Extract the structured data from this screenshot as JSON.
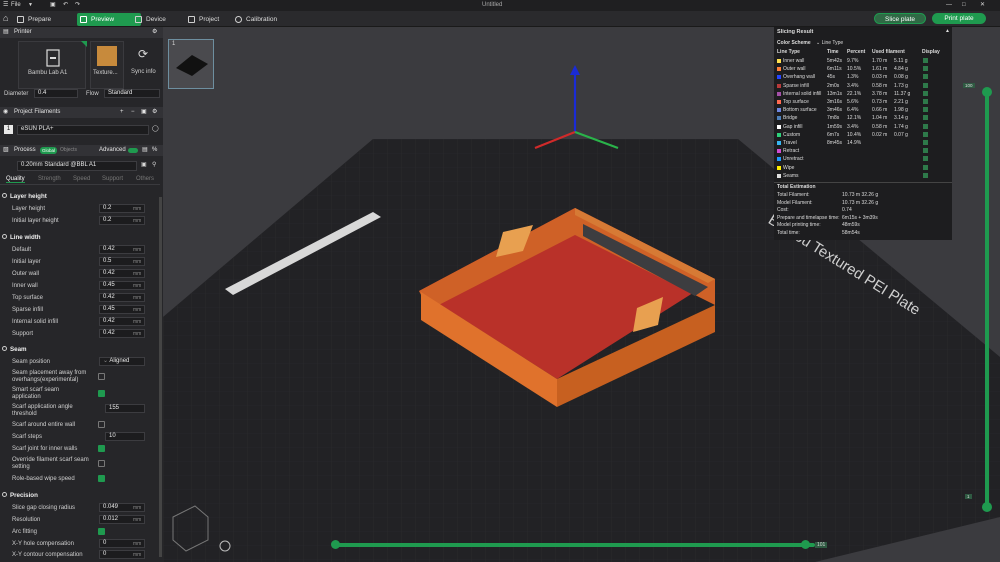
{
  "app": {
    "file_menu": "File",
    "document_title": "Untitled"
  },
  "tabs": [
    {
      "label": "Prepare"
    },
    {
      "label": "Preview"
    },
    {
      "label": "Device"
    },
    {
      "label": "Project"
    },
    {
      "label": "Calibration"
    }
  ],
  "actions": {
    "slice_plate": "Slice plate",
    "print_plate": "Print plate"
  },
  "printer": {
    "section_title": "Printer",
    "printer_name": "Bambu Lab A1",
    "plate_name": "Texture...",
    "sync_label": "Sync info",
    "diameter_label": "Diameter",
    "diameter_value": "0.4",
    "flow_label": "Flow",
    "flow_value": "Standard"
  },
  "filaments": {
    "section_title": "Project Filaments",
    "slot_number": "1",
    "filament_name": "eSUN PLA+"
  },
  "process": {
    "section_title": "Process",
    "toggle_global": "Global",
    "toggle_objects": "Objects",
    "advanced_label": "Advanced",
    "preset_name": "0.20mm Standard @BBL A1",
    "subtabs": [
      "Quality",
      "Strength",
      "Speed",
      "Support",
      "Others"
    ]
  },
  "layer_height": {
    "group_title": "Layer height",
    "rows": [
      {
        "label": "Layer height",
        "value": "0.2",
        "unit": "mm"
      },
      {
        "label": "Initial layer height",
        "value": "0.2",
        "unit": "mm"
      }
    ]
  },
  "line_width": {
    "group_title": "Line width",
    "rows": [
      {
        "label": "Default",
        "value": "0.42",
        "unit": "mm"
      },
      {
        "label": "Initial layer",
        "value": "0.5",
        "unit": "mm"
      },
      {
        "label": "Outer wall",
        "value": "0.42",
        "unit": "mm"
      },
      {
        "label": "Inner wall",
        "value": "0.45",
        "unit": "mm"
      },
      {
        "label": "Top surface",
        "value": "0.42",
        "unit": "mm"
      },
      {
        "label": "Sparse infill",
        "value": "0.45",
        "unit": "mm"
      },
      {
        "label": "Internal solid infill",
        "value": "0.42",
        "unit": "mm"
      },
      {
        "label": "Support",
        "value": "0.42",
        "unit": "mm"
      }
    ]
  },
  "seam": {
    "group_title": "Seam",
    "position_label": "Seam position",
    "position_value": "Aligned",
    "away_label_1": "Seam placement away from",
    "away_label_2": "overhangs(experimental)",
    "smart_label_1": "Smart scarf seam",
    "smart_label_2": "application",
    "angle_label_1": "Scarf application angle",
    "angle_label_2": "threshold",
    "angle_value": "155",
    "around_label": "Scarf around entire wall",
    "steps_label": "Scarf steps",
    "steps_value": "10",
    "inner_label": "Scarf joint for inner walls",
    "override_label_1": "Override filament scarf seam",
    "override_label_2": "setting",
    "role_label": "Role-based wipe speed"
  },
  "precision": {
    "group_title": "Precision",
    "rows": [
      {
        "label": "Slice gap closing radius",
        "value": "0.049",
        "unit": "mm"
      },
      {
        "label": "Resolution",
        "value": "0.012",
        "unit": "mm"
      },
      {
        "label": "Arc fitting",
        "value": "",
        "unit": ""
      },
      {
        "label": "X-Y hole compensation",
        "value": "0",
        "unit": "mm"
      },
      {
        "label": "X-Y contour compensation",
        "value": "0",
        "unit": "mm"
      }
    ]
  },
  "plate": {
    "thumb_number": "1",
    "bed_label": "Bambu Textured PEI Plate"
  },
  "slicing_result": {
    "title": "Slicing Result",
    "color_scheme_label": "Color Scheme",
    "color_scheme_value": "Line Type",
    "headers": [
      "Line Type",
      "Time",
      "Percent",
      "Used filament",
      "Display"
    ],
    "rows": [
      {
        "type": "Inner wall",
        "time": "5m42s",
        "percent": "9.7%",
        "length": "1.70 m",
        "weight": "5.11 g",
        "color": "#ffe14f"
      },
      {
        "type": "Outer wall",
        "time": "6m11s",
        "percent": "10.5%",
        "length": "1.61 m",
        "weight": "4.84 g",
        "color": "#ff7d38"
      },
      {
        "type": "Overhang wall",
        "time": "45s",
        "percent": "1.3%",
        "length": "0.03 m",
        "weight": "0.08 g",
        "color": "#2545ff"
      },
      {
        "type": "Sparse infill",
        "time": "2m0s",
        "percent": "3.4%",
        "length": "0.58 m",
        "weight": "1.73 g",
        "color": "#b83a3a"
      },
      {
        "type": "Internal solid infill",
        "time": "13m1s",
        "percent": "22.1%",
        "length": "3.78 m",
        "weight": "11.37 g",
        "color": "#a450a8"
      },
      {
        "type": "Top surface",
        "time": "3m16s",
        "percent": "5.6%",
        "length": "0.73 m",
        "weight": "2.21 g",
        "color": "#ff6a50"
      },
      {
        "type": "Bottom surface",
        "time": "3m46s",
        "percent": "6.4%",
        "length": "0.66 m",
        "weight": "1.98 g",
        "color": "#6e86e0"
      },
      {
        "type": "Bridge",
        "time": "7m8s",
        "percent": "12.1%",
        "length": "1.04 m",
        "weight": "3.14 g",
        "color": "#4d7fb8"
      },
      {
        "type": "Gap infill",
        "time": "1m59s",
        "percent": "3.4%",
        "length": "0.58 m",
        "weight": "1.74 g",
        "color": "#ffffff"
      },
      {
        "type": "Custom",
        "time": "6m7s",
        "percent": "10.4%",
        "length": "0.02 m",
        "weight": "0.07 g",
        "color": "#2dd17a"
      },
      {
        "type": "Travel",
        "time": "8m45s",
        "percent": "14.9%",
        "length": "",
        "weight": "",
        "color": "#37b5f0"
      },
      {
        "type": "Retract",
        "time": "",
        "percent": "",
        "length": "",
        "weight": "",
        "color": "#d14bd1"
      },
      {
        "type": "Unretract",
        "time": "",
        "percent": "",
        "length": "",
        "weight": "",
        "color": "#1f9bff"
      },
      {
        "type": "Wipe",
        "time": "",
        "percent": "",
        "length": "",
        "weight": "",
        "color": "#ffee00"
      },
      {
        "type": "Seams",
        "time": "",
        "percent": "",
        "length": "",
        "weight": "",
        "color": "#e0e0e0"
      }
    ],
    "estimation_title": "Total Estimation",
    "estimation": [
      {
        "label": "Total Filament:",
        "value": "10.73 m   32.26 g"
      },
      {
        "label": "Model Filament:",
        "value": "10.73 m   32.26 g"
      },
      {
        "label": "Cost:",
        "value": "0.74"
      },
      {
        "label": "Prepare and timelapse time:",
        "value": "6m15s + 3m39s"
      },
      {
        "label": "Model printing time:",
        "value": "48m59s"
      },
      {
        "label": "Total time:",
        "value": "58m54s"
      }
    ]
  },
  "layer_slider": {
    "top_label": "100",
    "bottom_label": "1"
  },
  "move_slider": {
    "end_label": "101"
  },
  "colors": {
    "accent": "#1f9a4f",
    "model_wall": "#e0722c",
    "model_floor": "#b93129"
  }
}
